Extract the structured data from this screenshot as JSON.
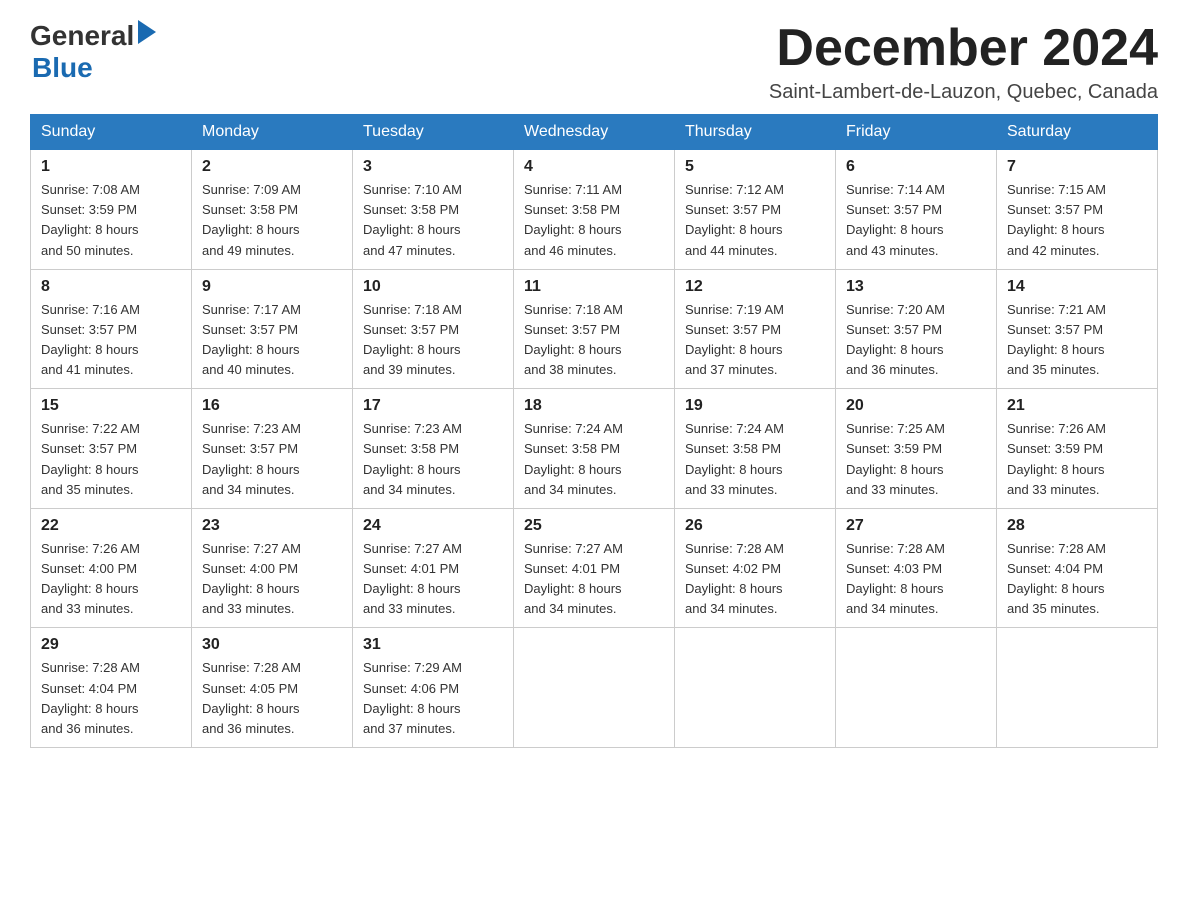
{
  "logo": {
    "general": "General",
    "blue": "Blue",
    "arrow": "▶"
  },
  "title": "December 2024",
  "location": "Saint-Lambert-de-Lauzon, Quebec, Canada",
  "days_of_week": [
    "Sunday",
    "Monday",
    "Tuesday",
    "Wednesday",
    "Thursday",
    "Friday",
    "Saturday"
  ],
  "weeks": [
    [
      {
        "day": "1",
        "sunrise": "7:08 AM",
        "sunset": "3:59 PM",
        "daylight": "8 hours and 50 minutes."
      },
      {
        "day": "2",
        "sunrise": "7:09 AM",
        "sunset": "3:58 PM",
        "daylight": "8 hours and 49 minutes."
      },
      {
        "day": "3",
        "sunrise": "7:10 AM",
        "sunset": "3:58 PM",
        "daylight": "8 hours and 47 minutes."
      },
      {
        "day": "4",
        "sunrise": "7:11 AM",
        "sunset": "3:58 PM",
        "daylight": "8 hours and 46 minutes."
      },
      {
        "day": "5",
        "sunrise": "7:12 AM",
        "sunset": "3:57 PM",
        "daylight": "8 hours and 44 minutes."
      },
      {
        "day": "6",
        "sunrise": "7:14 AM",
        "sunset": "3:57 PM",
        "daylight": "8 hours and 43 minutes."
      },
      {
        "day": "7",
        "sunrise": "7:15 AM",
        "sunset": "3:57 PM",
        "daylight": "8 hours and 42 minutes."
      }
    ],
    [
      {
        "day": "8",
        "sunrise": "7:16 AM",
        "sunset": "3:57 PM",
        "daylight": "8 hours and 41 minutes."
      },
      {
        "day": "9",
        "sunrise": "7:17 AM",
        "sunset": "3:57 PM",
        "daylight": "8 hours and 40 minutes."
      },
      {
        "day": "10",
        "sunrise": "7:18 AM",
        "sunset": "3:57 PM",
        "daylight": "8 hours and 39 minutes."
      },
      {
        "day": "11",
        "sunrise": "7:18 AM",
        "sunset": "3:57 PM",
        "daylight": "8 hours and 38 minutes."
      },
      {
        "day": "12",
        "sunrise": "7:19 AM",
        "sunset": "3:57 PM",
        "daylight": "8 hours and 37 minutes."
      },
      {
        "day": "13",
        "sunrise": "7:20 AM",
        "sunset": "3:57 PM",
        "daylight": "8 hours and 36 minutes."
      },
      {
        "day": "14",
        "sunrise": "7:21 AM",
        "sunset": "3:57 PM",
        "daylight": "8 hours and 35 minutes."
      }
    ],
    [
      {
        "day": "15",
        "sunrise": "7:22 AM",
        "sunset": "3:57 PM",
        "daylight": "8 hours and 35 minutes."
      },
      {
        "day": "16",
        "sunrise": "7:23 AM",
        "sunset": "3:57 PM",
        "daylight": "8 hours and 34 minutes."
      },
      {
        "day": "17",
        "sunrise": "7:23 AM",
        "sunset": "3:58 PM",
        "daylight": "8 hours and 34 minutes."
      },
      {
        "day": "18",
        "sunrise": "7:24 AM",
        "sunset": "3:58 PM",
        "daylight": "8 hours and 34 minutes."
      },
      {
        "day": "19",
        "sunrise": "7:24 AM",
        "sunset": "3:58 PM",
        "daylight": "8 hours and 33 minutes."
      },
      {
        "day": "20",
        "sunrise": "7:25 AM",
        "sunset": "3:59 PM",
        "daylight": "8 hours and 33 minutes."
      },
      {
        "day": "21",
        "sunrise": "7:26 AM",
        "sunset": "3:59 PM",
        "daylight": "8 hours and 33 minutes."
      }
    ],
    [
      {
        "day": "22",
        "sunrise": "7:26 AM",
        "sunset": "4:00 PM",
        "daylight": "8 hours and 33 minutes."
      },
      {
        "day": "23",
        "sunrise": "7:27 AM",
        "sunset": "4:00 PM",
        "daylight": "8 hours and 33 minutes."
      },
      {
        "day": "24",
        "sunrise": "7:27 AM",
        "sunset": "4:01 PM",
        "daylight": "8 hours and 33 minutes."
      },
      {
        "day": "25",
        "sunrise": "7:27 AM",
        "sunset": "4:01 PM",
        "daylight": "8 hours and 34 minutes."
      },
      {
        "day": "26",
        "sunrise": "7:28 AM",
        "sunset": "4:02 PM",
        "daylight": "8 hours and 34 minutes."
      },
      {
        "day": "27",
        "sunrise": "7:28 AM",
        "sunset": "4:03 PM",
        "daylight": "8 hours and 34 minutes."
      },
      {
        "day": "28",
        "sunrise": "7:28 AM",
        "sunset": "4:04 PM",
        "daylight": "8 hours and 35 minutes."
      }
    ],
    [
      {
        "day": "29",
        "sunrise": "7:28 AM",
        "sunset": "4:04 PM",
        "daylight": "8 hours and 36 minutes."
      },
      {
        "day": "30",
        "sunrise": "7:28 AM",
        "sunset": "4:05 PM",
        "daylight": "8 hours and 36 minutes."
      },
      {
        "day": "31",
        "sunrise": "7:29 AM",
        "sunset": "4:06 PM",
        "daylight": "8 hours and 37 minutes."
      },
      null,
      null,
      null,
      null
    ]
  ],
  "labels": {
    "sunrise": "Sunrise:",
    "sunset": "Sunset:",
    "daylight": "Daylight:"
  }
}
